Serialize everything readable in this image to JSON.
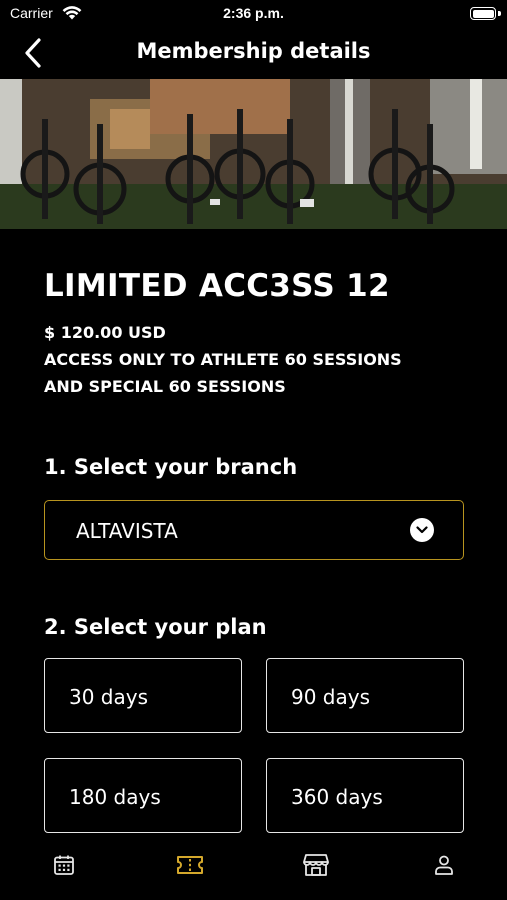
{
  "status_bar": {
    "carrier": "Carrier",
    "time": "2:36 p.m."
  },
  "nav": {
    "title": "Membership details",
    "back_icon": "chevron-left-icon"
  },
  "hero": {
    "image": "gym-air-bikes-photo"
  },
  "membership": {
    "name": "LIMITED ACC3SS 12",
    "price": "$ 120.00 USD",
    "description_lines": [
      "ACCESS ONLY TO ATHLETE 60 SESSIONS",
      "AND SPECIAL 60 SESSIONS"
    ]
  },
  "branch": {
    "title": "1. Select your branch",
    "selected": "ALTAVISTA",
    "dropdown_icon": "chevron-down-circle-icon"
  },
  "plan": {
    "title": "2. Select your plan",
    "options": [
      "30 days",
      "90 days",
      "180 days",
      "360 days"
    ]
  },
  "tab_bar": {
    "active_color": "#d4a82c",
    "inactive_color": "#e6e6e6",
    "tabs": [
      {
        "icon": "calendar-icon",
        "active": false
      },
      {
        "icon": "ticket-icon",
        "active": true
      },
      {
        "icon": "store-icon",
        "active": false
      },
      {
        "icon": "user-icon",
        "active": false
      }
    ]
  },
  "colors": {
    "accent": "#b8941f",
    "background": "#000000"
  }
}
